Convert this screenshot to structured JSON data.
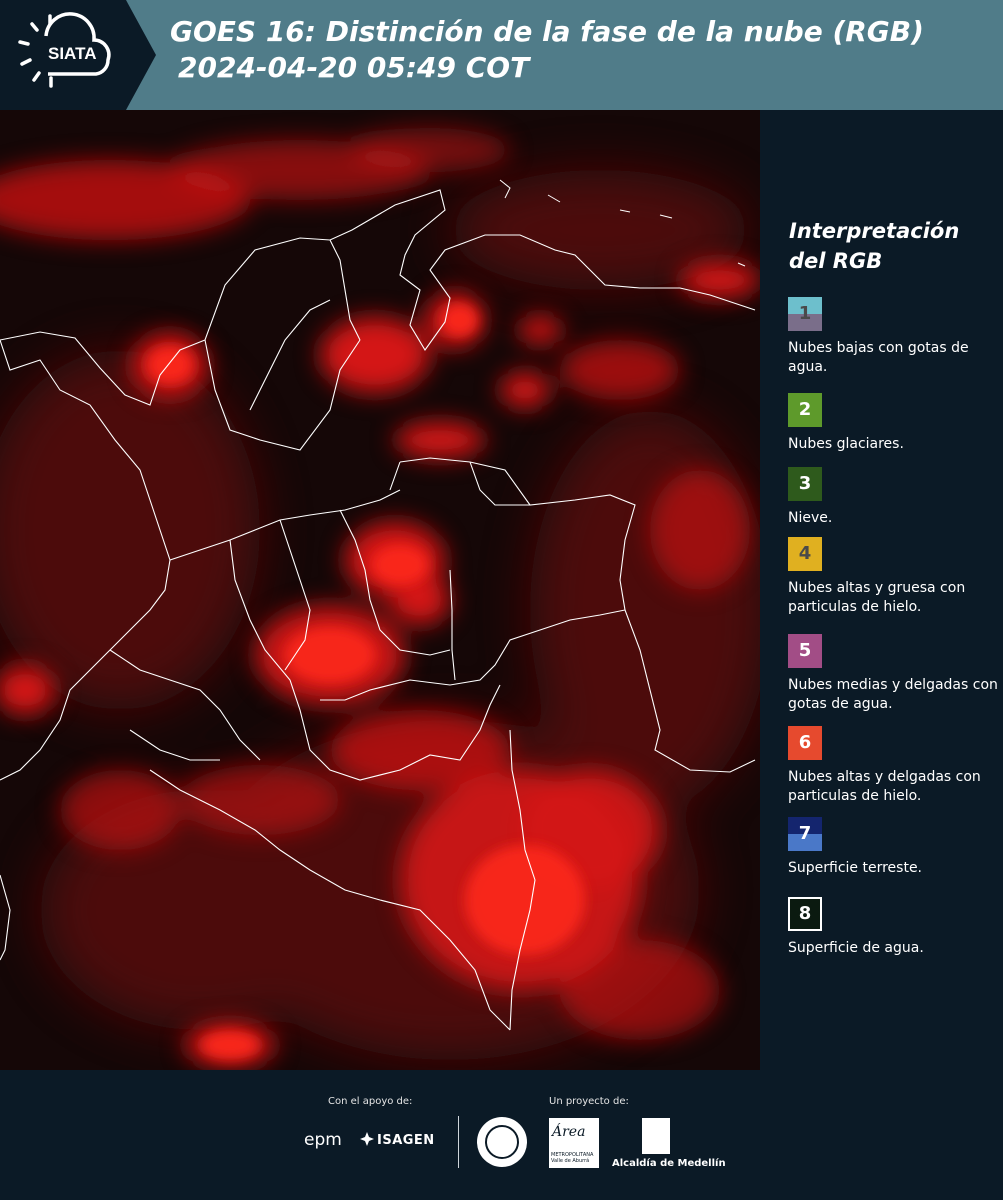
{
  "header": {
    "logo_text": "SIATA",
    "title_line1": "GOES 16: Distinción de la fase de la nube (RGB)",
    "title_line2": "2024-04-20 05:49 COT"
  },
  "legend": {
    "title": "Interpretación del RGB",
    "items": [
      {
        "number": "1",
        "label": "Nubes bajas con gotas de agua.",
        "color_top": "#6dbfcc",
        "color_bottom": "#7a6e8a",
        "number_color": "#4a4a4a"
      },
      {
        "number": "2",
        "label": "Nubes glaciares.",
        "color_top": "#5e9a2b",
        "color_bottom": "#5e9a2b",
        "number_color": "#ffffff"
      },
      {
        "number": "3",
        "label": "Nieve.",
        "color_top": "#2e5a1c",
        "color_bottom": "#2e5a1c",
        "number_color": "#ffffff"
      },
      {
        "number": "4",
        "label": "Nubes altas y gruesa con particulas de hielo.",
        "color_top": "#e0b020",
        "color_bottom": "#e0b020",
        "number_color": "#4a4a4a"
      },
      {
        "number": "5",
        "label": "Nubes medias y delgadas con gotas de agua.",
        "color_top": "#a24d86",
        "color_bottom": "#a24d86",
        "number_color": "#ffffff"
      },
      {
        "number": "6",
        "label": "Nubes altas y delgadas con particulas de hielo.",
        "color_top": "#e64a2e",
        "color_bottom": "#e64a2e",
        "number_color": "#ffffff"
      },
      {
        "number": "7",
        "label": "Superficie terreste.",
        "color_top": "#14256e",
        "color_bottom": "#4a78c8",
        "number_color": "#ffffff"
      },
      {
        "number": "8",
        "label": "Superficie de agua.",
        "color_top": "#0b1a10",
        "color_bottom": "#0b1a10",
        "number_color": "#ffffff"
      }
    ]
  },
  "footer": {
    "support_label": "Con el apoyo de:",
    "project_label": "Un proyecto de:",
    "epm_text": "epm",
    "isagen_text": "ISAGEN",
    "area_text": "Área",
    "area_subtext": "METROPOLITANA Valle de Aburrá",
    "alcaldia_text": "Alcaldía de Medellín"
  }
}
